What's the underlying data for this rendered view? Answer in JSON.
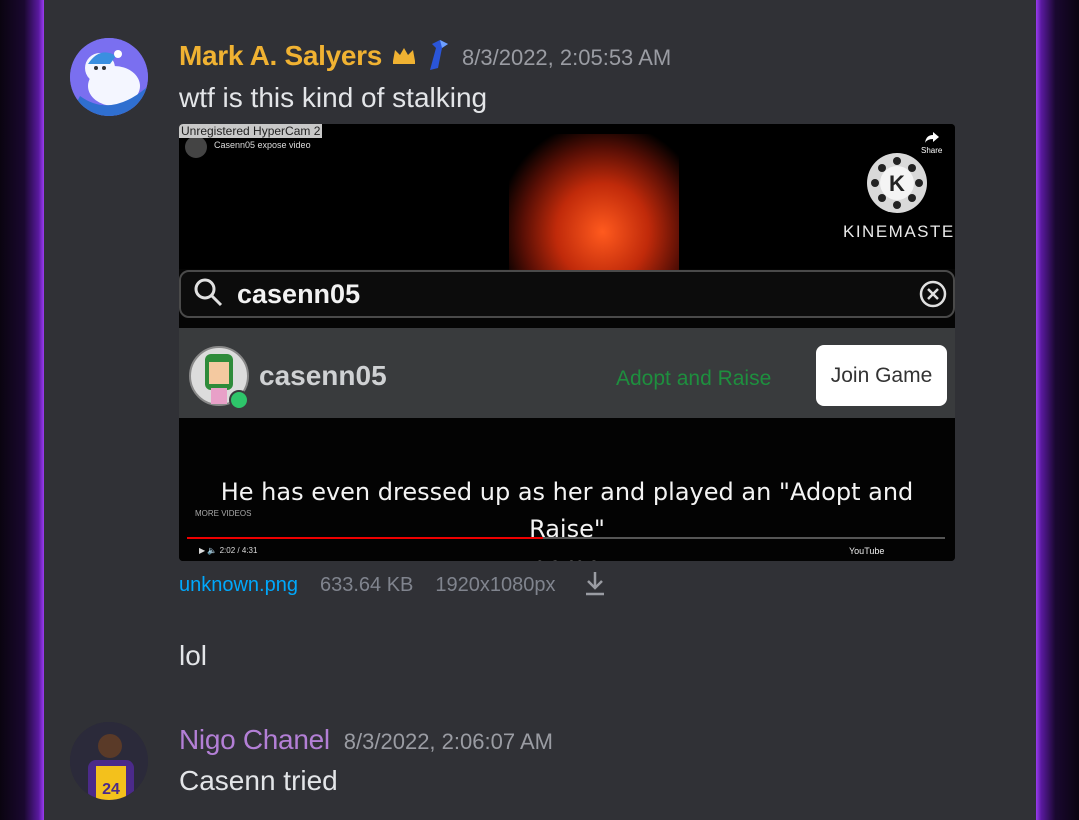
{
  "messages": [
    {
      "username": "Mark A. Salyers",
      "username_color": "#f0b232",
      "timestamp": "8/3/2022, 2:05:53 AM",
      "text": "wtf is this kind of stalking",
      "attachment": {
        "file_name": "unknown.png",
        "file_size": "633.64 KB",
        "dimensions": "1920x1080px",
        "image": {
          "overlay_label": "Unregistered HyperCam 2",
          "video_title": "Casenn05 expose video",
          "share_label": "Share",
          "watermark": "KINEMASTER",
          "watermark_letter": "K",
          "search_query": "casenn05",
          "result_username": "casenn05",
          "result_game": "Adopt and Raise",
          "join_button": "Join Game",
          "caption_line1": "He has even dressed up as her and played an \"Adopt and Raise\"",
          "caption_line2": "game",
          "more_videos": "MORE VIDEOS",
          "player_time": "2:02 / 4:31",
          "youtube_label": "YouTube",
          "progress": 0.47
        }
      }
    },
    {
      "text": "lol"
    },
    {
      "username": "Nigo Chanel",
      "username_color": "#b37fd6",
      "timestamp": "8/3/2022, 2:06:07 AM",
      "text": "Casenn tried",
      "jersey_number": "24"
    }
  ],
  "icons": {
    "crown": "crown-icon",
    "badge": "nitro-badge-icon",
    "search": "search-icon",
    "clear": "clear-icon",
    "download": "download-icon"
  }
}
